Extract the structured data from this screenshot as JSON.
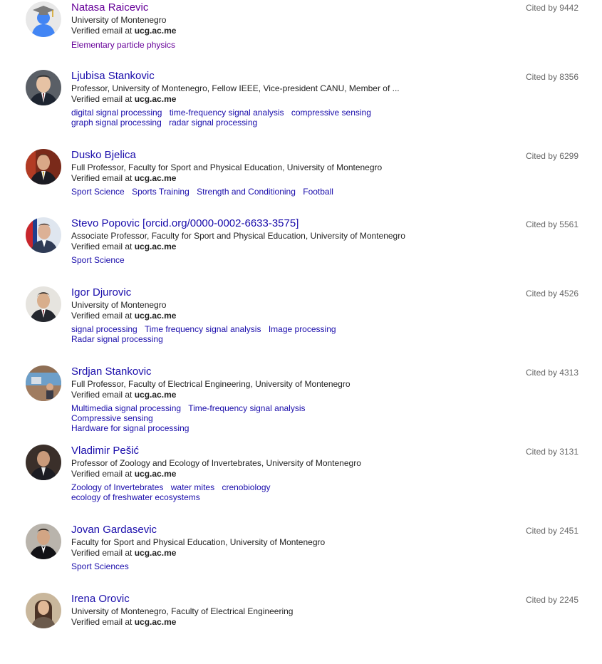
{
  "profiles": [
    {
      "name": "Natasa Raicevic",
      "affiliation": "University of Montenegro",
      "email_prefix": "Verified email at ",
      "email_domain": "ucg.ac.me",
      "interests": [
        "Elementary particle physics"
      ],
      "cited": "Cited by 9442",
      "avatar": "graduate-placeholder-icon"
    },
    {
      "name": "Ljubisa Stankovic",
      "affiliation": "Professor, University of Montenegro, Fellow IEEE, Vice-president CANU, Member of ...",
      "email_prefix": "Verified email at ",
      "email_domain": "ucg.ac.me",
      "interests": [
        "digital signal processing",
        "time-frequency signal analysis",
        "compressive sensing",
        "graph signal processing",
        "radar signal processing"
      ],
      "cited": "Cited by 8356",
      "avatar": "profile-photo"
    },
    {
      "name": "Dusko Bjelica",
      "affiliation": "Full Professor, Faculty for Sport and Physical Education, University of Montenegro",
      "email_prefix": "Verified email at ",
      "email_domain": "ucg.ac.me",
      "interests": [
        "Sport Science",
        "Sports Training",
        "Strength and Conditioning",
        "Football"
      ],
      "cited": "Cited by 6299",
      "avatar": "profile-photo"
    },
    {
      "name": "Stevo Popovic [orcid.org/0000-0002-6633-3575]",
      "affiliation": "Associate Professor, Faculty for Sport and Physical Education, University of Montenegro",
      "email_prefix": "Verified email at ",
      "email_domain": "ucg.ac.me",
      "interests": [
        "Sport Science"
      ],
      "cited": "Cited by 5561",
      "avatar": "profile-photo"
    },
    {
      "name": "Igor Djurovic",
      "affiliation": "University of Montenegro",
      "email_prefix": "Verified email at ",
      "email_domain": "ucg.ac.me",
      "interests": [
        "signal processing",
        "Time frequency signal analysis",
        "Image processing",
        "Radar signal processing"
      ],
      "cited": "Cited by 4526",
      "avatar": "profile-photo"
    },
    {
      "name": "Srdjan Stankovic",
      "affiliation": "Full Professor, Faculty of Electrical Engineering, University of Montenegro",
      "email_prefix": "Verified email at ",
      "email_domain": "ucg.ac.me",
      "interests": [
        "Multimedia signal processing",
        "Time-frequency signal analysis",
        "Compressive sensing",
        "Hardware for signal processing"
      ],
      "cited": "Cited by 4313",
      "avatar": "profile-photo"
    },
    {
      "name": "Vladimir Pešić",
      "affiliation": "Professor of Zoology and Ecology of Invertebrates, University of Montenegro",
      "email_prefix": "Verified email at ",
      "email_domain": "ucg.ac.me",
      "interests": [
        "Zoology of Invertebrates",
        "water mites",
        "crenobiology",
        "ecology of freshwater ecosystems"
      ],
      "cited": "Cited by 3131",
      "avatar": "profile-photo"
    },
    {
      "name": "Jovan Gardasevic",
      "affiliation": "Faculty for Sport and Physical Education, University of Montenegro",
      "email_prefix": "Verified email at ",
      "email_domain": "ucg.ac.me",
      "interests": [
        "Sport Sciences"
      ],
      "cited": "Cited by 2451",
      "avatar": "profile-photo"
    },
    {
      "name": "Irena Orovic",
      "affiliation": "University of Montenegro, Faculty of Electrical Engineering",
      "email_prefix": "Verified email at ",
      "email_domain": "ucg.ac.me",
      "interests": [],
      "cited": "Cited by 2245",
      "avatar": "profile-photo"
    }
  ],
  "colors": {
    "link": "#1a0dab",
    "visited_link": "#660099",
    "text": "#222222",
    "cited": "#666666"
  }
}
